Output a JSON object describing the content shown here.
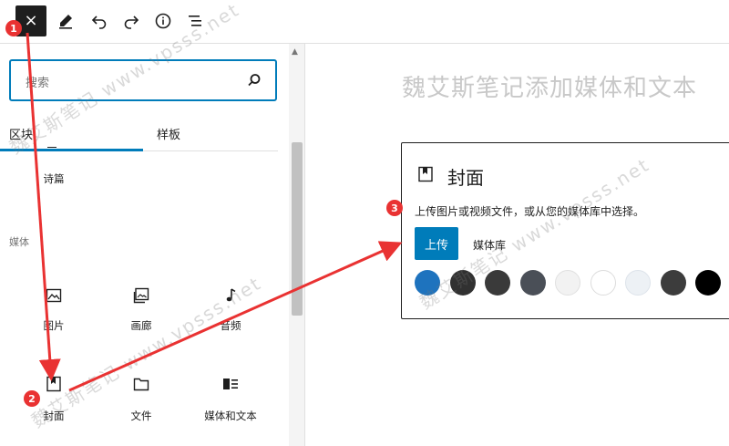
{
  "toolbar": {
    "close_glyph": "×",
    "icons": [
      "close-icon",
      "pencil-icon",
      "undo-icon",
      "redo-icon",
      "info-icon",
      "list-view-icon"
    ]
  },
  "inserter": {
    "search": {
      "placeholder": "搜索"
    },
    "tabs": [
      {
        "label": "区块",
        "active": true
      },
      {
        "label": "样板",
        "active": false
      }
    ],
    "text_section": {
      "items": [
        {
          "label": "诗篇"
        }
      ]
    },
    "media_category": "媒体",
    "media_blocks": [
      {
        "label": "图片",
        "icon": "image-icon"
      },
      {
        "label": "画廊",
        "icon": "gallery-icon"
      },
      {
        "label": "音频",
        "icon": "audio-icon"
      },
      {
        "label": "封面",
        "icon": "cover-icon"
      },
      {
        "label": "文件",
        "icon": "file-icon"
      },
      {
        "label": "媒体和文本",
        "icon": "media-text-icon"
      }
    ]
  },
  "editor": {
    "title": "魏艾斯笔记添加媒体和文本"
  },
  "cover_block": {
    "title": "封面",
    "instructions": "上传图片或视频文件，或从您的媒体库中选择。",
    "upload_label": "上传",
    "library_label": "媒体库",
    "swatches": [
      "#1e73be",
      "#313131",
      "#3a3a3a",
      "#4a4f57",
      "#f2f2f2",
      "#ffffff",
      "#edf1f5",
      "#3c3c3c",
      "#000000"
    ]
  },
  "annotations": {
    "markers": [
      "1",
      "2",
      "3"
    ],
    "arrow_color": "#e93232"
  },
  "watermarks": [
    "魏艾斯笔记 www.vpsss.net",
    "魏艾斯笔记 www.vpsss.net",
    "魏艾斯笔记 www.vpsss.net"
  ]
}
